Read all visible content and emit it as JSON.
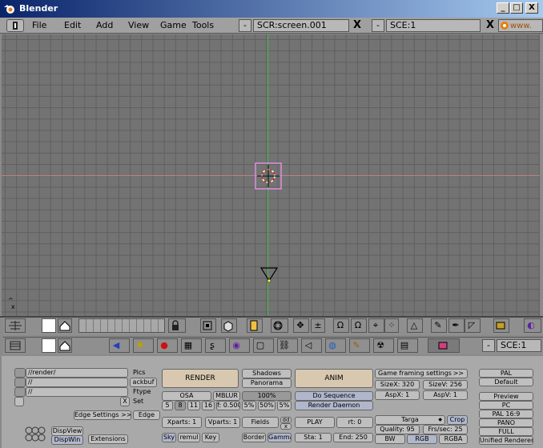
{
  "window": {
    "title": "Blender",
    "min_glyph": "_",
    "max_glyph": "□",
    "close_glyph": "X"
  },
  "menubar": {
    "items": [
      "File",
      "Edit",
      "Add",
      "View",
      "Game",
      "Tools"
    ],
    "screen_field": "SCR:screen.001",
    "scene_field": "SCE:1",
    "close_glyph": "X",
    "minus_glyph": "-",
    "url_fragment": "www."
  },
  "viewport": {
    "axis_label": "x",
    "axis_caret": "^"
  },
  "buttons_header": {
    "scene_field": "SCE:1",
    "minus_glyph": "-"
  },
  "render_panel": {
    "paths": {
      "render": "//render/",
      "backbuf": "//",
      "ftype": "//"
    },
    "path_labels": {
      "pics": "Pics",
      "backbuf": "ackbuf",
      "ftype": "Ftype",
      "set": "Set"
    },
    "x_glyph": "X",
    "edge_settings": "Edge Settings >>",
    "edge": "Edge",
    "dispview": "DispView",
    "dispwin": "DispWin",
    "extensions": "Extensions",
    "render": "RENDER",
    "shadows": "Shadows",
    "panorama": "Panorama",
    "osa": "OSA",
    "mblur": "MBLUR",
    "blur_pct": "100%",
    "osa_levels": [
      "5",
      "8",
      "11",
      "16"
    ],
    "filter": "f: 0.500",
    "pcts": [
      "5%",
      "50%",
      "5%"
    ],
    "xparts": "Xparts: 1",
    "yparts": "Vparts: 1",
    "fields": "Fields",
    "odd": "dd",
    "x_small": "x",
    "sky": "Sky",
    "premul": "remul",
    "key": "Key",
    "border": "Border",
    "gamma": "Gamma",
    "anim": "ANIM",
    "do_sequence": "Do Sequence",
    "render_daemon": "Render Daemon",
    "play": "PLAY",
    "rt": "rt: 0",
    "sta": "Sta: 1",
    "end": "End: 250",
    "game_framing": "Game framing settings",
    "gf_arrows": ">>",
    "sizex": "SizeX: 320",
    "sizey": "SizeV: 256",
    "aspx": "AspX: 1",
    "aspy": "AspV: 1",
    "targa": "Targa",
    "crop": "Crop",
    "quality": "Quality: 95",
    "frs": "Frs/sec: 25",
    "bw": "BW",
    "rgb": "RGB",
    "rgba": "RGBA",
    "presets": [
      "PAL",
      "Default",
      "Preview",
      "PC",
      "PAL 16:9",
      "PANO",
      "FULL",
      "Unified Renderer"
    ]
  },
  "colors": {
    "titlebar_from": "#0a246a",
    "titlebar_to": "#a6caf0",
    "grid": "#737373",
    "x_axis": "#c08080",
    "y_axis": "#40c040"
  }
}
